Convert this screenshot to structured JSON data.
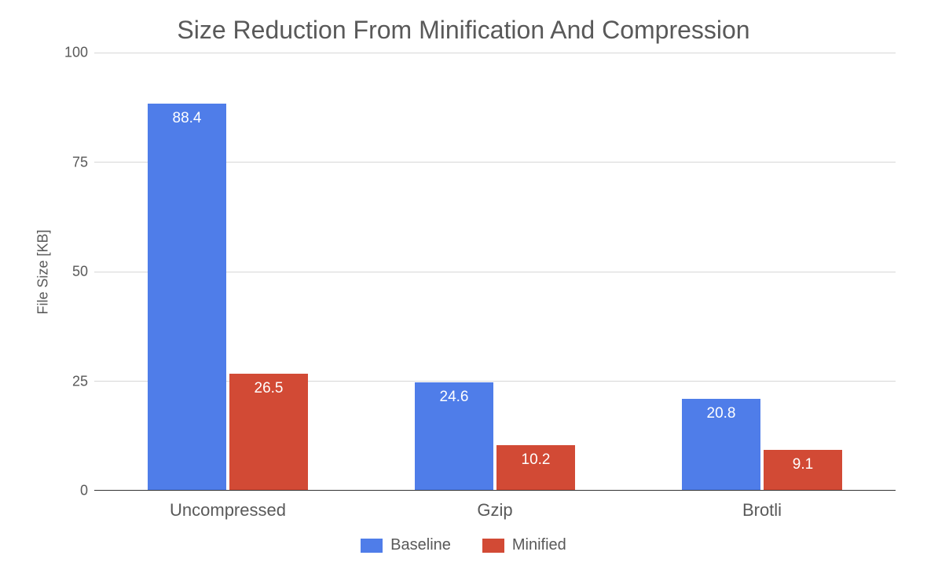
{
  "chart_data": {
    "type": "bar",
    "title": "Size Reduction From Minification And Compression",
    "xlabel": "",
    "ylabel": "File Size [KB]",
    "ylim": [
      0,
      100
    ],
    "yticks": [
      0,
      25,
      50,
      75,
      100
    ],
    "categories": [
      "Uncompressed",
      "Gzip",
      "Brotli"
    ],
    "series": [
      {
        "name": "Baseline",
        "values": [
          88.4,
          24.6,
          20.8
        ],
        "color": "#4f7de9"
      },
      {
        "name": "Minified",
        "values": [
          26.5,
          10.2,
          9.1
        ],
        "color": "#d24a35"
      }
    ],
    "legend_position": "bottom",
    "grid": true
  }
}
